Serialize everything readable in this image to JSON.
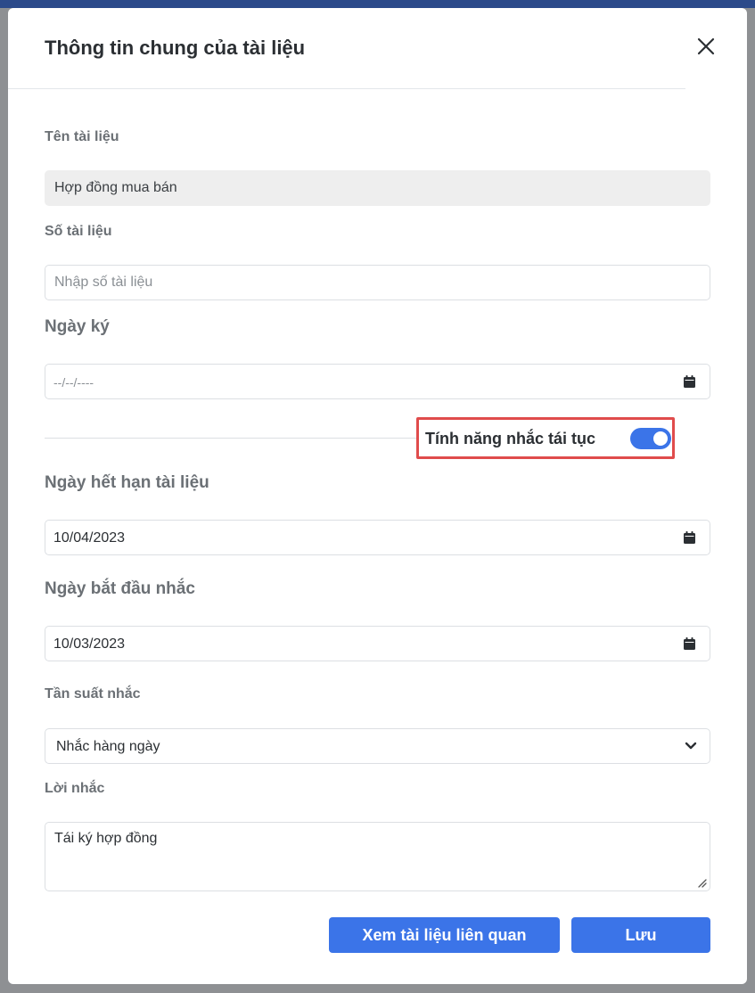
{
  "dialog": {
    "title": "Thông tin chung của tài liệu"
  },
  "doc_name": {
    "label": "Tên tài liệu",
    "value": "Hợp đồng mua bán"
  },
  "doc_number": {
    "label": "Số tài liệu",
    "placeholder": "Nhập số tài liệu"
  },
  "sign_date": {
    "label": "Ngày ký",
    "placeholder": "--/--/----"
  },
  "renewal": {
    "label": "Tính năng nhắc tái tục",
    "enabled": true
  },
  "expiry_date": {
    "label": "Ngày hết hạn tài liệu",
    "value": "10/04/2023"
  },
  "remind_start": {
    "label": "Ngày bắt đầu nhắc",
    "value": "10/03/2023"
  },
  "frequency": {
    "label": "Tần suất nhắc",
    "selected": "Nhắc hàng ngày"
  },
  "message": {
    "label": "Lời nhắc",
    "value": "Tái ký hợp đồng"
  },
  "buttons": {
    "related": "Xem tài liệu liên quan",
    "save": "Lưu"
  },
  "colors": {
    "primary": "#3b74e8",
    "highlight": "#e04c4c"
  },
  "icons": [
    "close-icon",
    "calendar-icon",
    "chevron-down-icon",
    "resize-handle-icon"
  ]
}
